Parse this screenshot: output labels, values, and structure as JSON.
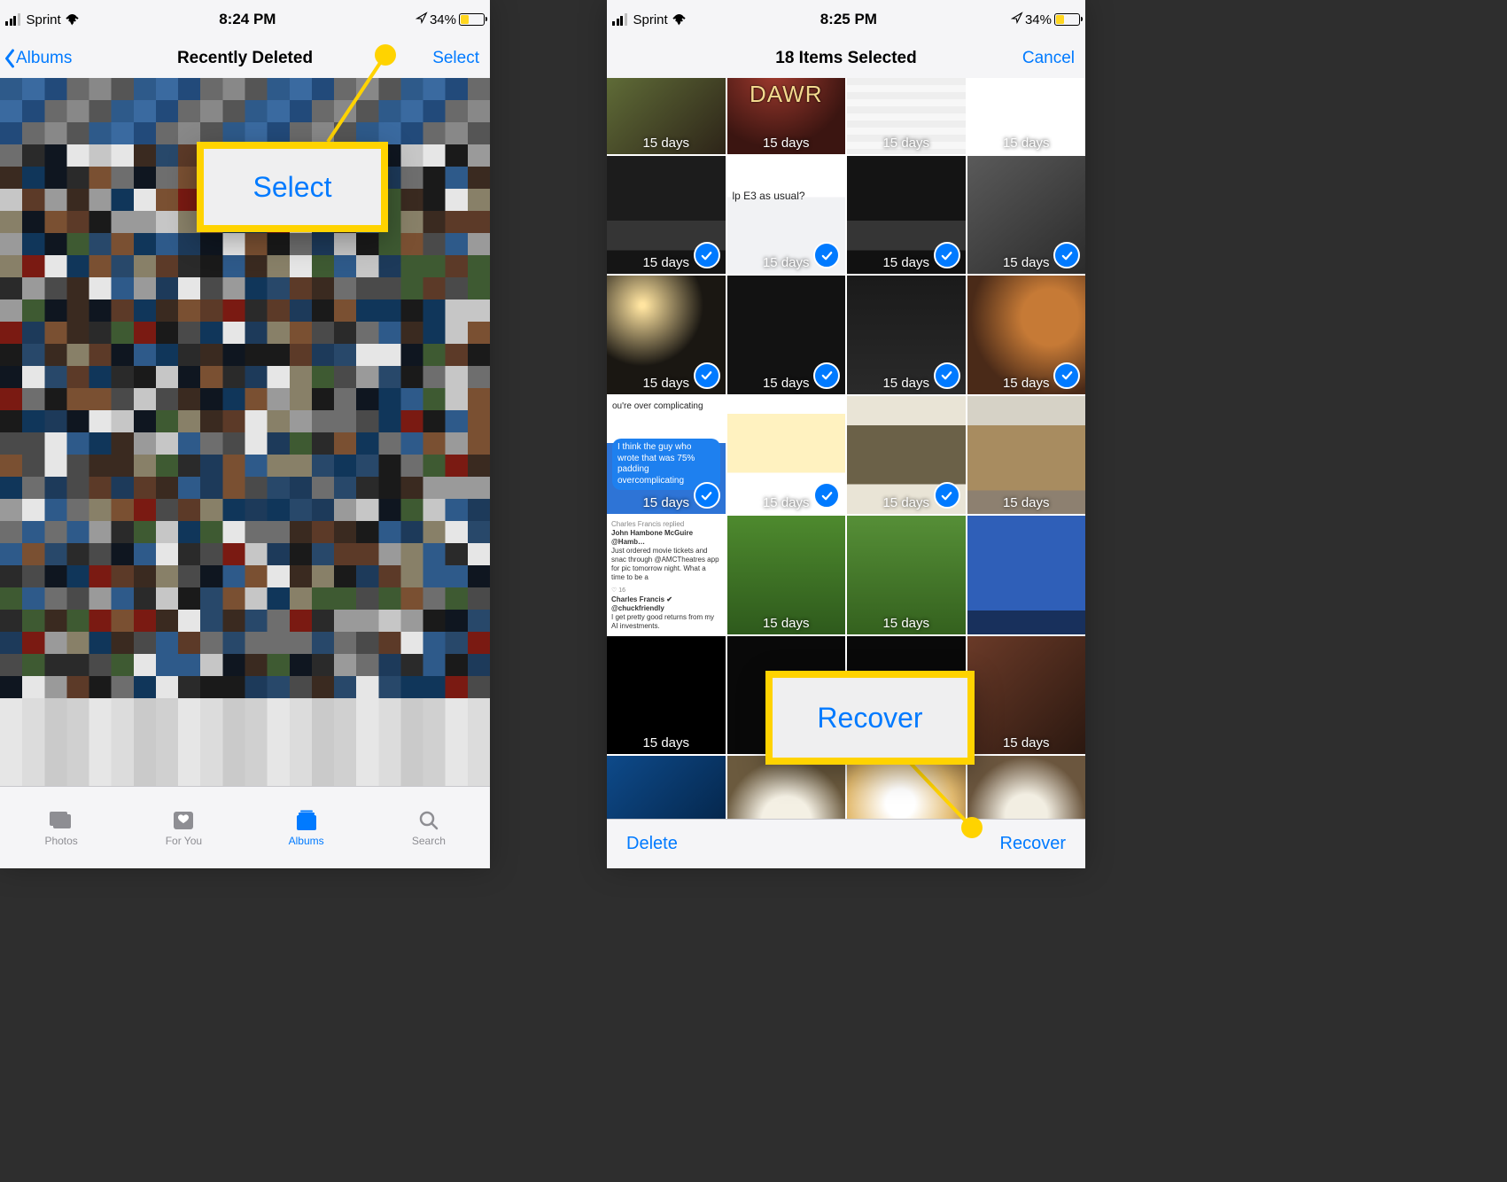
{
  "colors": {
    "ios_blue": "#007aff",
    "callout_yellow": "#ffd300",
    "battery_yellow": "#ffd61f"
  },
  "left": {
    "status": {
      "carrier": "Sprint",
      "time": "8:24 PM",
      "battery_pct": "34%"
    },
    "nav": {
      "back_label": "Albums",
      "title": "Recently Deleted",
      "right_button": "Select"
    },
    "callout_text": "Select",
    "tabs": {
      "photos": "Photos",
      "for_you": "For You",
      "albums": "Albums",
      "search": "Search",
      "active": "Albums"
    }
  },
  "right": {
    "status": {
      "carrier": "Sprint",
      "time": "8:25 PM",
      "battery_pct": "34%"
    },
    "nav": {
      "title": "18 Items Selected",
      "right_button": "Cancel"
    },
    "callout_text": "Recover",
    "toolbar": {
      "delete": "Delete",
      "recover": "Recover"
    },
    "thumbnails": [
      {
        "days": "15 days",
        "selected": false,
        "bg": "bg-a",
        "overlay": ""
      },
      {
        "days": "15 days",
        "selected": false,
        "bg": "bg-b",
        "overlay": "DAWR"
      },
      {
        "days": "15 days",
        "selected": false,
        "bg": "bg-c",
        "overlay": ""
      },
      {
        "days": "15 days",
        "selected": false,
        "bg": "bg-d",
        "overlay": ""
      },
      {
        "days": "15 days",
        "selected": true,
        "bg": "bg-e",
        "overlay": ""
      },
      {
        "days": "15 days",
        "selected": true,
        "bg": "bg-f",
        "overlay": "lp E3 as usual?"
      },
      {
        "days": "15 days",
        "selected": true,
        "bg": "bg-g",
        "overlay": ""
      },
      {
        "days": "15 days",
        "selected": true,
        "bg": "bg-h",
        "overlay": ""
      },
      {
        "days": "15 days",
        "selected": true,
        "bg": "bg-i",
        "overlay": ""
      },
      {
        "days": "15 days",
        "selected": true,
        "bg": "bg-j",
        "overlay": ""
      },
      {
        "days": "15 days",
        "selected": true,
        "bg": "bg-k",
        "overlay": ""
      },
      {
        "days": "15 days",
        "selected": true,
        "bg": "bg-l",
        "overlay": ""
      },
      {
        "days": "15 days",
        "selected": true,
        "bg": "bg-m",
        "overlay": "ou're over complicating\n\nI think the guy who wrote that was 75% padding overcomplicating"
      },
      {
        "days": "15 days",
        "selected": true,
        "bg": "bg-n",
        "overlay": ""
      },
      {
        "days": "15 days",
        "selected": true,
        "bg": "bg-o",
        "overlay": ""
      },
      {
        "days": "15 days",
        "selected": false,
        "bg": "bg-p",
        "overlay": ""
      },
      {
        "days": "",
        "selected": false,
        "bg": "bg-q",
        "overlay": "tweet"
      },
      {
        "days": "15 days",
        "selected": false,
        "bg": "bg-r",
        "overlay": ""
      },
      {
        "days": "15 days",
        "selected": false,
        "bg": "bg-s",
        "overlay": ""
      },
      {
        "days": "",
        "selected": false,
        "bg": "bg-t",
        "overlay": ""
      },
      {
        "days": "15 days",
        "selected": false,
        "bg": "bg-u",
        "overlay": ""
      },
      {
        "days": "",
        "selected": false,
        "bg": "bg-v",
        "overlay": ""
      },
      {
        "days": "",
        "selected": false,
        "bg": "bg-v",
        "overlay": ""
      },
      {
        "days": "15 days",
        "selected": false,
        "bg": "bg-w",
        "overlay": ""
      },
      {
        "days": "",
        "selected": false,
        "bg": "bg-x",
        "overlay": ""
      },
      {
        "days": "",
        "selected": false,
        "bg": "bg-y",
        "overlay": ""
      },
      {
        "days": "",
        "selected": false,
        "bg": "bg-z",
        "overlay": ""
      },
      {
        "days": "",
        "selected": false,
        "bg": "bg-aa",
        "overlay": ""
      }
    ],
    "tweet_text": {
      "l1": "Charles Francis replied",
      "l2": "John Hambone McGuire @Hamb…",
      "l3": "Just ordered movie tickets and snac through @AMCTheatres app for pic tomorrow night. What a time to be a",
      "l4": "Charles Francis ✔ @chuckfriendly",
      "l5": "I get pretty good returns from my AI investments."
    }
  }
}
